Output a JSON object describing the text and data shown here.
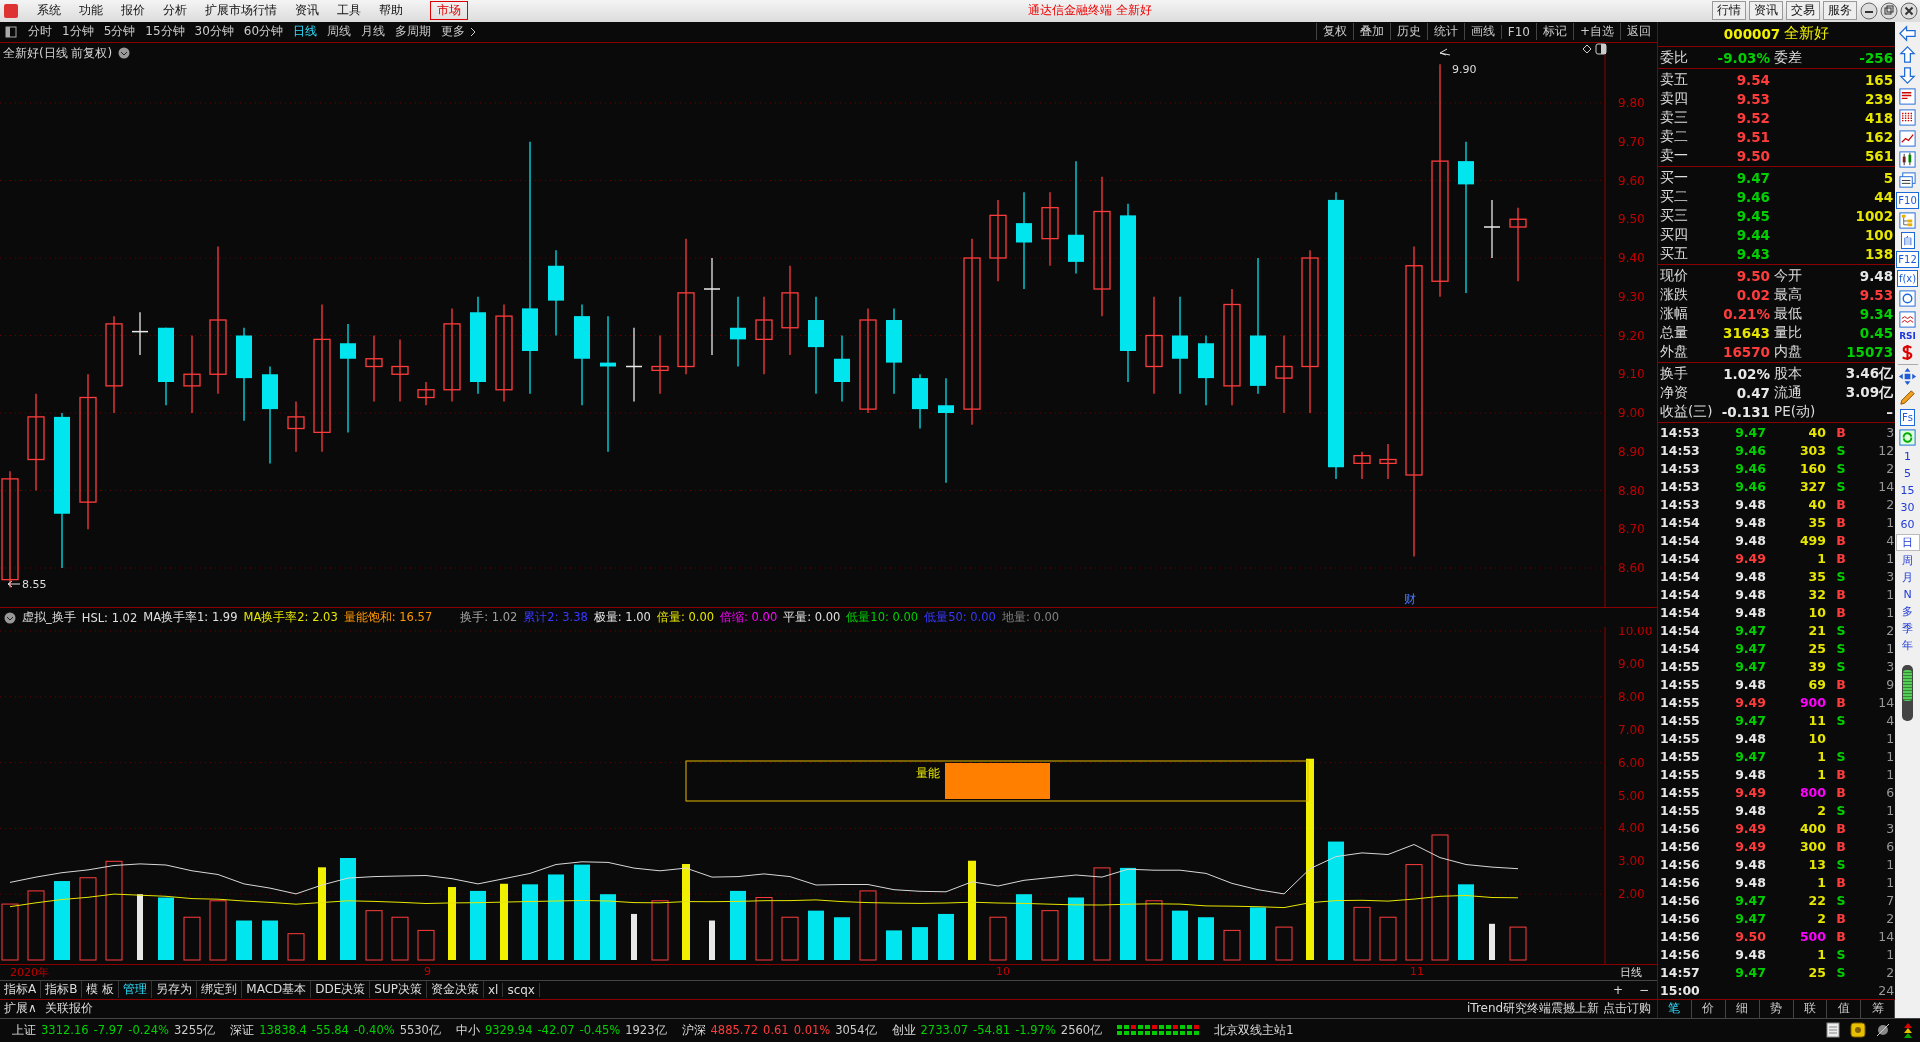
{
  "menu_bar": {
    "items": [
      "系统",
      "功能",
      "报价",
      "分析",
      "扩展市场行情",
      "资讯",
      "工具",
      "帮助"
    ],
    "market": "市场",
    "title": "通达信金融终端  全新好",
    "buttons": [
      "行情",
      "资讯",
      "交易",
      "服务"
    ]
  },
  "toolbar": {
    "periods": [
      {
        "label": "分时",
        "selected": false
      },
      {
        "label": "1分钟",
        "selected": false
      },
      {
        "label": "5分钟",
        "selected": false
      },
      {
        "label": "15分钟",
        "selected": false
      },
      {
        "label": "30分钟",
        "selected": false
      },
      {
        "label": "60分钟",
        "selected": false
      },
      {
        "label": "日线",
        "selected": true
      },
      {
        "label": "周线",
        "selected": false
      },
      {
        "label": "月线",
        "selected": false
      },
      {
        "label": "多周期",
        "selected": false
      }
    ],
    "more": "更多",
    "actions": [
      "复权",
      "叠加",
      "历史",
      "统计",
      "画线",
      "F10",
      "标记",
      "+自选",
      "返回"
    ]
  },
  "chart": {
    "title": "全新好(日线 前复权)",
    "price_ticks": [
      "9.80",
      "9.70",
      "9.60",
      "9.50",
      "9.40",
      "9.30",
      "9.20",
      "9.10",
      "9.00",
      "8.90",
      "8.80",
      "8.70",
      "8.60"
    ],
    "high_label": "9.90",
    "low_label": "8.55",
    "event_marker": "财"
  },
  "indicator": {
    "name": "虚拟_换手",
    "values": [
      {
        "text": "HSL: 1.02",
        "color": "#e0e0e0"
      },
      {
        "text": "MA换手率1: 1.99",
        "color": "#e0e0e0"
      },
      {
        "text": "MA换手率2: 2.03",
        "color": "#e6e600"
      },
      {
        "text": "量能饱和: 16.57",
        "color": "#ff9900"
      },
      {
        "text": "换手: 1.02",
        "color": "#a0a0a0"
      },
      {
        "text": "累计2: 3.38",
        "color": "#3838ff"
      },
      {
        "text": "极量: 1.00",
        "color": "#e0e0e0"
      },
      {
        "text": "倍量: 0.00",
        "color": "#e6e600"
      },
      {
        "text": "倍缩: 0.00",
        "color": "#ff00ff"
      },
      {
        "text": "平量: 0.00",
        "color": "#e0e0e0"
      },
      {
        "text": "低量10: 0.00",
        "color": "#00d000"
      },
      {
        "text": "低量50: 0.00",
        "color": "#3838ff"
      },
      {
        "text": "地量: 0.00",
        "color": "#808080"
      }
    ]
  },
  "volume": {
    "ticks": [
      "10.00",
      "9.00",
      "8.00",
      "7.00",
      "6.00",
      "5.00",
      "4.00",
      "3.00",
      "2.00"
    ],
    "box_label": "量能"
  },
  "date_axis": {
    "labels": [
      "2020年",
      "9",
      "10",
      "11"
    ],
    "period": "日线"
  },
  "bottom_tabs": [
    {
      "label": "指标A",
      "selected": false
    },
    {
      "label": "指标B",
      "selected": false
    },
    {
      "label": "模 板",
      "selected": false
    },
    {
      "label": "管理",
      "selected": true
    },
    {
      "label": "另存为",
      "selected": false
    },
    {
      "label": "绑定到",
      "selected": false
    },
    {
      "label": "MACD基本",
      "selected": false
    },
    {
      "label": "DDE决策",
      "selected": false
    },
    {
      "label": "SUP决策",
      "selected": false
    },
    {
      "label": "资金决策",
      "selected": false
    },
    {
      "label": "xl",
      "selected": false
    },
    {
      "label": "scqx",
      "selected": false
    }
  ],
  "zoom_buttons": [
    "+",
    "−"
  ],
  "extension": {
    "items": [
      "扩展∧",
      "关联报价"
    ],
    "promo": "iTrend研究终端震撼上新 点击订购"
  },
  "quote": {
    "code": "000007",
    "name": "全新好",
    "ratio": [
      {
        "label": "委比",
        "value": "-9.03%",
        "color": "#00d000"
      },
      {
        "label": "委差",
        "value": "-256",
        "color": "#00d000"
      }
    ],
    "sells": [
      {
        "label": "卖五",
        "price": "9.54",
        "volume": "165"
      },
      {
        "label": "卖四",
        "price": "9.53",
        "volume": "239"
      },
      {
        "label": "卖三",
        "price": "9.52",
        "volume": "418"
      },
      {
        "label": "卖二",
        "price": "9.51",
        "volume": "162"
      },
      {
        "label": "卖一",
        "price": "9.50",
        "volume": "561"
      }
    ],
    "buys": [
      {
        "label": "买一",
        "price": "9.47",
        "volume": "5"
      },
      {
        "label": "买二",
        "price": "9.46",
        "volume": "44"
      },
      {
        "label": "买三",
        "price": "9.45",
        "volume": "1002"
      },
      {
        "label": "买四",
        "price": "9.44",
        "volume": "100"
      },
      {
        "label": "买五",
        "price": "9.43",
        "volume": "138"
      }
    ],
    "stats": [
      [
        {
          "label": "现价",
          "value": "9.50",
          "color": "#ff3c3c"
        },
        {
          "label": "今开",
          "value": "9.48",
          "color": "#e8e8e8"
        }
      ],
      [
        {
          "label": "涨跌",
          "value": "0.02",
          "color": "#ff3c3c"
        },
        {
          "label": "最高",
          "value": "9.53",
          "color": "#ff3c3c"
        }
      ],
      [
        {
          "label": "涨幅",
          "value": "0.21%",
          "color": "#ff3c3c"
        },
        {
          "label": "最低",
          "value": "9.34",
          "color": "#00d000"
        }
      ],
      [
        {
          "label": "总量",
          "value": "31643",
          "color": "#e6e600"
        },
        {
          "label": "量比",
          "value": "0.45",
          "color": "#00d000"
        }
      ],
      [
        {
          "label": "外盘",
          "value": "16570",
          "color": "#ff3c3c"
        },
        {
          "label": "内盘",
          "value": "15073",
          "color": "#00d000"
        }
      ]
    ],
    "fundamentals": [
      [
        {
          "label": "换手",
          "value": "1.02%"
        },
        {
          "label": "股本",
          "value": "3.46亿"
        }
      ],
      [
        {
          "label": "净资",
          "value": "0.47"
        },
        {
          "label": "流通",
          "value": "3.09亿"
        }
      ],
      [
        {
          "label": "收益(三)",
          "value": "-0.131"
        },
        {
          "label": "PE(动)",
          "value": "–"
        }
      ]
    ]
  },
  "ticks": [
    {
      "time": "14:53",
      "price": "9.47",
      "color": "#00d000",
      "volume": "40",
      "big": false,
      "side": "B",
      "buy": true,
      "count": "3"
    },
    {
      "time": "14:53",
      "price": "9.46",
      "color": "#00d000",
      "volume": "303",
      "big": false,
      "side": "S",
      "buy": false,
      "count": "12"
    },
    {
      "time": "14:53",
      "price": "9.46",
      "color": "#00d000",
      "volume": "160",
      "big": false,
      "side": "S",
      "buy": false,
      "count": "2"
    },
    {
      "time": "14:53",
      "price": "9.46",
      "color": "#00d000",
      "volume": "327",
      "big": false,
      "side": "S",
      "buy": false,
      "count": "14"
    },
    {
      "time": "14:53",
      "price": "9.48",
      "color": "#e8e8e8",
      "volume": "40",
      "big": false,
      "side": "B",
      "buy": true,
      "count": "2"
    },
    {
      "time": "14:54",
      "price": "9.48",
      "color": "#e8e8e8",
      "volume": "35",
      "big": false,
      "side": "B",
      "buy": true,
      "count": "1"
    },
    {
      "time": "14:54",
      "price": "9.48",
      "color": "#e8e8e8",
      "volume": "499",
      "big": false,
      "side": "B",
      "buy": true,
      "count": "4"
    },
    {
      "time": "14:54",
      "price": "9.49",
      "color": "#ff3c3c",
      "volume": "1",
      "big": false,
      "side": "B",
      "buy": true,
      "count": "1"
    },
    {
      "time": "14:54",
      "price": "9.48",
      "color": "#e8e8e8",
      "volume": "35",
      "big": false,
      "side": "S",
      "buy": false,
      "count": "3"
    },
    {
      "time": "14:54",
      "price": "9.48",
      "color": "#e8e8e8",
      "volume": "32",
      "big": false,
      "side": "B",
      "buy": true,
      "count": "1"
    },
    {
      "time": "14:54",
      "price": "9.48",
      "color": "#e8e8e8",
      "volume": "10",
      "big": false,
      "side": "B",
      "buy": true,
      "count": "1"
    },
    {
      "time": "14:54",
      "price": "9.47",
      "color": "#00d000",
      "volume": "21",
      "big": false,
      "side": "S",
      "buy": false,
      "count": "2"
    },
    {
      "time": "14:54",
      "price": "9.47",
      "color": "#00d000",
      "volume": "25",
      "big": false,
      "side": "S",
      "buy": false,
      "count": "1"
    },
    {
      "time": "14:55",
      "price": "9.47",
      "color": "#00d000",
      "volume": "39",
      "big": false,
      "side": "S",
      "buy": false,
      "count": "3"
    },
    {
      "time": "14:55",
      "price": "9.48",
      "color": "#e8e8e8",
      "volume": "69",
      "big": false,
      "side": "B",
      "buy": true,
      "count": "9"
    },
    {
      "time": "14:55",
      "price": "9.49",
      "color": "#ff3c3c",
      "volume": "900",
      "big": true,
      "side": "B",
      "buy": true,
      "count": "14"
    },
    {
      "time": "14:55",
      "price": "9.47",
      "color": "#00d000",
      "volume": "11",
      "big": false,
      "side": "S",
      "buy": false,
      "count": "4"
    },
    {
      "time": "14:55",
      "price": "9.48",
      "color": "#e8e8e8",
      "volume": "10",
      "big": false,
      "count": "1"
    },
    {
      "time": "14:55",
      "price": "9.47",
      "color": "#00d000",
      "volume": "1",
      "big": false,
      "side": "S",
      "buy": false,
      "count": "1"
    },
    {
      "time": "14:55",
      "price": "9.48",
      "color": "#e8e8e8",
      "volume": "1",
      "big": false,
      "side": "B",
      "buy": true,
      "count": "1"
    },
    {
      "time": "14:55",
      "price": "9.49",
      "color": "#ff3c3c",
      "volume": "800",
      "big": true,
      "side": "B",
      "buy": true,
      "count": "6"
    },
    {
      "time": "14:55",
      "price": "9.48",
      "color": "#e8e8e8",
      "volume": "2",
      "big": false,
      "side": "S",
      "buy": false,
      "count": "1"
    },
    {
      "time": "14:56",
      "price": "9.49",
      "color": "#ff3c3c",
      "volume": "400",
      "big": false,
      "side": "B",
      "buy": true,
      "count": "3"
    },
    {
      "time": "14:56",
      "price": "9.49",
      "color": "#ff3c3c",
      "volume": "300",
      "big": false,
      "side": "B",
      "buy": true,
      "count": "6"
    },
    {
      "time": "14:56",
      "price": "9.48",
      "color": "#e8e8e8",
      "volume": "13",
      "big": false,
      "side": "S",
      "buy": false,
      "count": "1"
    },
    {
      "time": "14:56",
      "price": "9.48",
      "color": "#e8e8e8",
      "volume": "1",
      "big": false,
      "side": "B",
      "buy": true,
      "count": "1"
    },
    {
      "time": "14:56",
      "price": "9.47",
      "color": "#00d000",
      "volume": "22",
      "big": false,
      "side": "S",
      "buy": false,
      "count": "7"
    },
    {
      "time": "14:56",
      "price": "9.47",
      "color": "#00d000",
      "volume": "2",
      "big": false,
      "side": "B",
      "buy": true,
      "count": "2"
    },
    {
      "time": "14:56",
      "price": "9.50",
      "color": "#ff3c3c",
      "volume": "500",
      "big": true,
      "side": "B",
      "buy": true,
      "count": "14"
    },
    {
      "time": "14:56",
      "price": "9.48",
      "color": "#e8e8e8",
      "volume": "1",
      "big": false,
      "side": "S",
      "buy": false,
      "count": "1"
    },
    {
      "time": "14:57",
      "price": "9.47",
      "color": "#00d000",
      "volume": "25",
      "big": false,
      "side": "S",
      "buy": false,
      "count": "2"
    },
    {
      "time": "15:00",
      "count": "24"
    }
  ],
  "trade_tabs": [
    {
      "label": "笔",
      "selected": true
    },
    {
      "label": "价",
      "selected": false
    },
    {
      "label": "细",
      "selected": false
    },
    {
      "label": "势",
      "selected": false
    },
    {
      "label": "联",
      "selected": false
    },
    {
      "label": "值",
      "selected": false
    },
    {
      "label": "筹",
      "selected": false
    }
  ],
  "side_icons": [
    {
      "kind": "left"
    },
    {
      "kind": "up"
    },
    {
      "kind": "down"
    },
    {
      "kind": "report"
    },
    {
      "kind": "grid"
    },
    {
      "kind": "trend"
    },
    {
      "kind": "candles"
    },
    {
      "kind": "windows"
    },
    {
      "kind": "boxed",
      "text": "F10"
    },
    {
      "kind": "tree"
    },
    {
      "kind": "boxed",
      "text": "自"
    },
    {
      "kind": "boxed",
      "text": "F12"
    },
    {
      "kind": "boxed",
      "text": "f(x)"
    },
    {
      "kind": "circle"
    },
    {
      "kind": "wave"
    },
    {
      "kind": "plain",
      "text": "RSI"
    },
    {
      "kind": "dollar"
    },
    {
      "kind": "move"
    },
    {
      "kind": "pencil"
    },
    {
      "kind": "boxed",
      "text": "Fs"
    },
    {
      "kind": "refresh"
    }
  ],
  "side_periods": [
    {
      "label": "1",
      "selected": false
    },
    {
      "label": "5",
      "selected": false
    },
    {
      "label": "15",
      "selected": false
    },
    {
      "label": "30",
      "selected": false
    },
    {
      "label": "60",
      "selected": false
    },
    {
      "label": "日",
      "selected": true
    },
    {
      "label": "周",
      "selected": false
    },
    {
      "label": "月",
      "selected": false
    },
    {
      "label": "N",
      "selected": false
    },
    {
      "label": "多",
      "selected": false
    },
    {
      "label": "季",
      "selected": false
    },
    {
      "label": "年",
      "selected": false
    }
  ],
  "status_bar": {
    "indices": [
      {
        "name": "上证",
        "value": "3312.16",
        "change": "-7.97",
        "percent": "-0.24%",
        "amount": "3255亿",
        "up": false
      },
      {
        "name": "深证",
        "value": "13838.4",
        "change": "-55.84",
        "percent": "-0.40%",
        "amount": "5530亿",
        "up": false
      },
      {
        "name": "中小",
        "value": "9329.94",
        "change": "-42.07",
        "percent": "-0.45%",
        "amount": "1923亿",
        "up": false
      },
      {
        "name": "沪深",
        "value": "4885.72",
        "change": "0.61",
        "percent": "0.01%",
        "amount": "3054亿",
        "up": true
      },
      {
        "name": "创业",
        "value": "2733.07",
        "change": "-54.81",
        "percent": "-1.97%",
        "amount": "2560亿",
        "up": false
      }
    ],
    "server": "北京双线主站1"
  }
}
